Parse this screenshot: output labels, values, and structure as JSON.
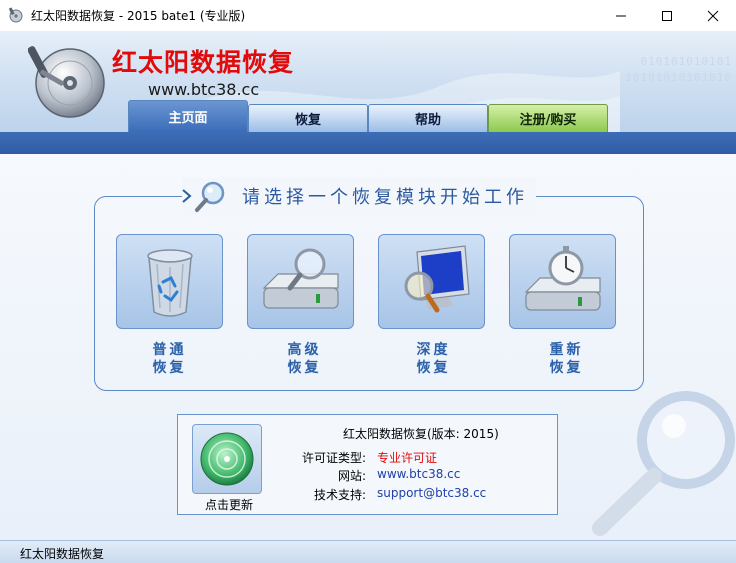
{
  "window": {
    "title": "红太阳数据恢复 - 2015 bate1 (专业版)"
  },
  "brand": {
    "title": "红太阳数据恢复",
    "url": "www.btc38.cc",
    "binary_row1": "010101010101",
    "binary_row2": "10101010101010"
  },
  "tabs": [
    {
      "label": "主页面",
      "active": true
    },
    {
      "label": "恢复",
      "active": false
    },
    {
      "label": "帮助",
      "active": false
    },
    {
      "label": "注册/购买",
      "active": false
    }
  ],
  "main": {
    "prompt": "请选择一个恢复模块开始工作",
    "modules": [
      {
        "line1": "普通",
        "line2": "恢复",
        "icon": "recycle-bin-icon"
      },
      {
        "line1": "高级",
        "line2": "恢复",
        "icon": "disk-magnifier-icon"
      },
      {
        "line1": "深度",
        "line2": "恢复",
        "icon": "monitor-magnifier-icon"
      },
      {
        "line1": "重新",
        "line2": "恢复",
        "icon": "disk-stopwatch-icon"
      }
    ]
  },
  "info": {
    "version_line": "红太阳数据恢复(版本: 2015)",
    "update_label": "点击更新",
    "license_key": "许可证类型:",
    "license_value": "专业许可证",
    "website_key": "网站:",
    "website_value": "www.btc38.cc",
    "support_key": "技术支持:",
    "support_value": "support@btc38.cc"
  },
  "status": {
    "text": "红太阳数据恢复"
  },
  "colors": {
    "brand_red": "#e10b0b",
    "tab_active": "#3a6cb8",
    "tab_register": "#8cc94e",
    "module_label": "#2d62ab",
    "link_blue": "#1e3fa8"
  }
}
